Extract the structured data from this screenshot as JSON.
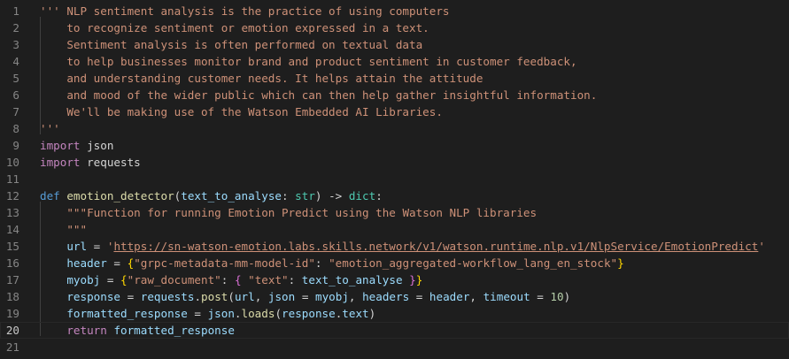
{
  "editor": {
    "current_line": 20,
    "lines": [
      {
        "n": "1",
        "tokens": [
          [
            "s",
            "''' NLP sentiment analysis is the practice of using computers"
          ]
        ]
      },
      {
        "n": "2",
        "tokens": [
          [
            "s",
            "    to recognize sentiment or emotion expressed in a text."
          ]
        ]
      },
      {
        "n": "3",
        "tokens": [
          [
            "s",
            "    Sentiment analysis is often performed on textual data"
          ]
        ]
      },
      {
        "n": "4",
        "tokens": [
          [
            "s",
            "    to help businesses monitor brand and product sentiment in customer feedback,"
          ]
        ]
      },
      {
        "n": "5",
        "tokens": [
          [
            "s",
            "    and understanding customer needs. It helps attain the attitude"
          ]
        ]
      },
      {
        "n": "6",
        "tokens": [
          [
            "s",
            "    and mood of the wider public which can then help gather insightful information."
          ]
        ]
      },
      {
        "n": "7",
        "tokens": [
          [
            "s",
            "    We'll be making use of the Watson Embedded AI Libraries."
          ]
        ]
      },
      {
        "n": "8",
        "tokens": [
          [
            "s",
            "'''"
          ]
        ]
      },
      {
        "n": "9",
        "tokens": [
          [
            "k",
            "import"
          ],
          [
            "p",
            " json"
          ]
        ]
      },
      {
        "n": "10",
        "tokens": [
          [
            "k",
            "import"
          ],
          [
            "p",
            " requests"
          ]
        ]
      },
      {
        "n": "11",
        "tokens": []
      },
      {
        "n": "12",
        "tokens": [
          [
            "d",
            "def"
          ],
          [
            "p",
            " "
          ],
          [
            "f",
            "emotion_detector"
          ],
          [
            "p",
            "("
          ],
          [
            "v",
            "text_to_analyse"
          ],
          [
            "p",
            ": "
          ],
          [
            "t",
            "str"
          ],
          [
            "p",
            ") -> "
          ],
          [
            "t",
            "dict"
          ],
          [
            "p",
            ":"
          ]
        ]
      },
      {
        "n": "13",
        "tokens": [
          [
            "p",
            "    "
          ],
          [
            "s",
            "\"\"\"Function for running Emotion Predict using the Watson NLP libraries"
          ]
        ]
      },
      {
        "n": "14",
        "tokens": [
          [
            "p",
            "    "
          ],
          [
            "s",
            "\"\"\""
          ]
        ]
      },
      {
        "n": "15",
        "tokens": [
          [
            "p",
            "    "
          ],
          [
            "v",
            "url"
          ],
          [
            "p",
            " = "
          ],
          [
            "s",
            "'"
          ],
          [
            "u",
            "https://sn-watson-emotion.labs.skills.network/v1/watson.runtime.nlp.v1/NlpService/EmotionPredict"
          ],
          [
            "s",
            "'"
          ]
        ]
      },
      {
        "n": "16",
        "tokens": [
          [
            "p",
            "    "
          ],
          [
            "v",
            "header"
          ],
          [
            "p",
            " = "
          ],
          [
            "b",
            "{"
          ],
          [
            "s",
            "\"grpc-metadata-mm-model-id\""
          ],
          [
            "p",
            ": "
          ],
          [
            "s",
            "\"emotion_aggregated-workflow_lang_en_stock\""
          ],
          [
            "b",
            "}"
          ]
        ]
      },
      {
        "n": "17",
        "tokens": [
          [
            "p",
            "    "
          ],
          [
            "v",
            "myobj"
          ],
          [
            "p",
            " = "
          ],
          [
            "b",
            "{"
          ],
          [
            "s",
            "\"raw_document\""
          ],
          [
            "p",
            ": "
          ],
          [
            "c",
            "{"
          ],
          [
            "p",
            " "
          ],
          [
            "s",
            "\"text\""
          ],
          [
            "p",
            ": "
          ],
          [
            "v",
            "text_to_analyse"
          ],
          [
            "p",
            " "
          ],
          [
            "c",
            "}"
          ],
          [
            "b",
            "}"
          ]
        ]
      },
      {
        "n": "18",
        "tokens": [
          [
            "p",
            "    "
          ],
          [
            "v",
            "response"
          ],
          [
            "p",
            " = "
          ],
          [
            "v",
            "requests"
          ],
          [
            "p",
            "."
          ],
          [
            "f",
            "post"
          ],
          [
            "p",
            "("
          ],
          [
            "v",
            "url"
          ],
          [
            "p",
            ", "
          ],
          [
            "v",
            "json"
          ],
          [
            "p",
            " = "
          ],
          [
            "v",
            "myobj"
          ],
          [
            "p",
            ", "
          ],
          [
            "v",
            "headers"
          ],
          [
            "p",
            " = "
          ],
          [
            "v",
            "header"
          ],
          [
            "p",
            ", "
          ],
          [
            "v",
            "timeout"
          ],
          [
            "p",
            " = "
          ],
          [
            "n",
            "10"
          ],
          [
            "p",
            ")"
          ]
        ]
      },
      {
        "n": "19",
        "tokens": [
          [
            "p",
            "    "
          ],
          [
            "v",
            "formatted_response"
          ],
          [
            "p",
            " = "
          ],
          [
            "v",
            "json"
          ],
          [
            "p",
            "."
          ],
          [
            "f",
            "loads"
          ],
          [
            "p",
            "("
          ],
          [
            "v",
            "response"
          ],
          [
            "p",
            "."
          ],
          [
            "v",
            "text"
          ],
          [
            "p",
            ")"
          ]
        ]
      },
      {
        "n": "20",
        "tokens": [
          [
            "p",
            "    "
          ],
          [
            "k",
            "return"
          ],
          [
            "p",
            " "
          ],
          [
            "v",
            "formatted_response"
          ]
        ]
      },
      {
        "n": "21",
        "tokens": []
      }
    ]
  }
}
